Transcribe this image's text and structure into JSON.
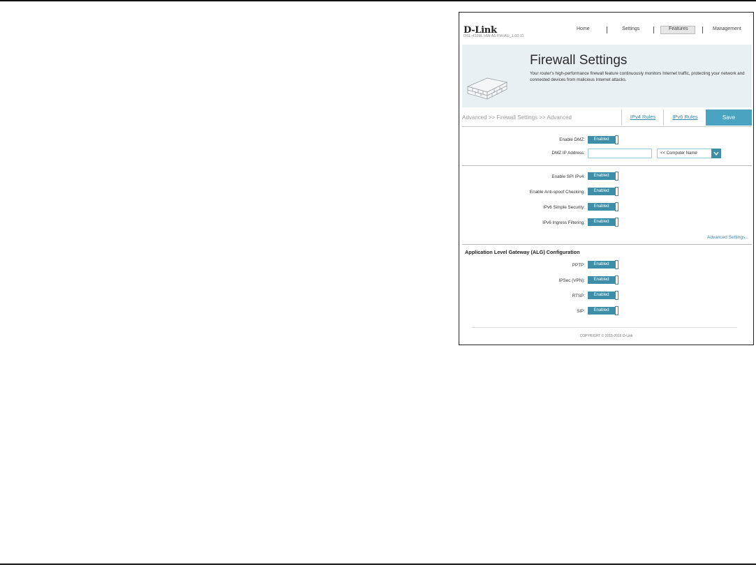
{
  "brand": {
    "logo": "D-Link",
    "model_info": "DSL-4320L  HW:A1  FW:AU_1.00.11"
  },
  "nav": {
    "home": "Home",
    "settings": "Settings",
    "features": "Features",
    "management": "Management"
  },
  "banner": {
    "title": "Firewall Settings",
    "description": "Your router's high-performance firewall feature continuously monitors Internet traffic, protecting your network and connected devices from malicious Internet attacks."
  },
  "breadcrumb": "Advanced >> Firewall Settings >> Advanced",
  "tabs": {
    "ipv4": "IPv4 Rules",
    "ipv6": "IPv6 Rules",
    "save": "Save"
  },
  "dmz": {
    "enable_label": "Enable DMZ:",
    "enable_value": "Enabled",
    "ip_label": "DMZ IP Address:",
    "ip_value": "",
    "computer_select": "<< Computer Name"
  },
  "security": [
    {
      "label": "Enable SPI IPv4:",
      "value": "Enabled"
    },
    {
      "label": "Enable Anti-spoof Checking:",
      "value": "Enabled"
    },
    {
      "label": "IPv6 Simple Security:",
      "value": "Enabled"
    },
    {
      "label": "IPv6 Ingress Filtering:",
      "value": "Enabled"
    }
  ],
  "advanced_link": "Advanced Settings...",
  "alg": {
    "title": "Application Level Gateway (ALG) Configuration",
    "items": [
      {
        "label": "PPTP:",
        "value": "Enabled"
      },
      {
        "label": "IPSec (VPN):",
        "value": "Enabled"
      },
      {
        "label": "RTSP:",
        "value": "Enabled"
      },
      {
        "label": "SIP:",
        "value": "Enabled"
      }
    ]
  },
  "copyright": "COPYRIGHT © 2015-2016 D-Link",
  "colors": {
    "accent": "#3f8ea8",
    "save": "#4aa3c0",
    "banner_bg": "#e9f0f3"
  }
}
